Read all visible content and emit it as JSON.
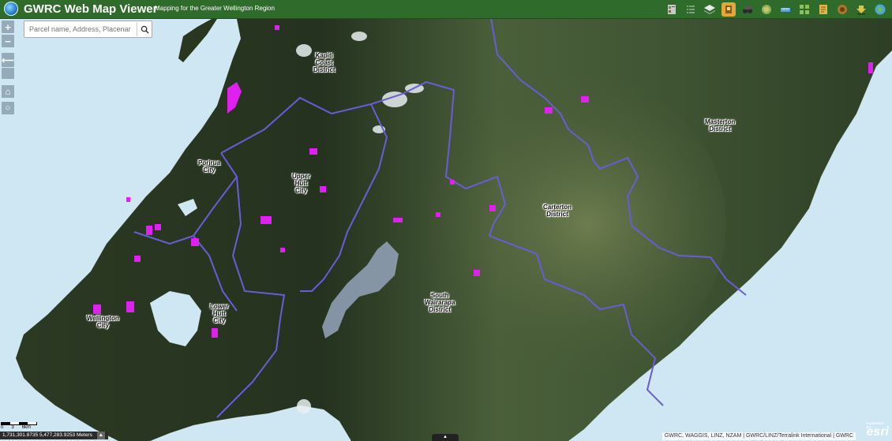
{
  "header": {
    "app_title": "GWRC Web Map Viewer",
    "subtitle": "Mapping for the Greater Wellington Region",
    "tools": [
      {
        "icon": "legend-icon",
        "color": "#c9c9c9"
      },
      {
        "icon": "list-icon",
        "color": "#7fa07a"
      },
      {
        "icon": "layers-icon",
        "color": "#e8e8e8"
      },
      {
        "icon": "basemap-icon",
        "color": "#e0a83a"
      },
      {
        "icon": "binoculars-icon",
        "color": "#e8e8e8"
      },
      {
        "icon": "globe-puzzle-icon",
        "color": "#86b35a"
      },
      {
        "icon": "measure-icon",
        "color": "#5aa2d8"
      },
      {
        "icon": "grid-icon",
        "color": "#8fbf5a"
      },
      {
        "icon": "map-book-icon",
        "color": "#e0b54a"
      },
      {
        "icon": "compass-icon",
        "color": "#b0742a"
      },
      {
        "icon": "download-icon",
        "color": "#e2c23a"
      },
      {
        "icon": "help-globe-icon",
        "color": "#4ba3e0"
      }
    ]
  },
  "search": {
    "placeholder": "Parcel name, Address, Placenar"
  },
  "map_controls": {
    "zoom_in": "+",
    "zoom_out": "−",
    "back": "⟵",
    "home": "⌂",
    "locate": "○"
  },
  "map_labels": [
    {
      "id": "kapiti",
      "lines": [
        "Kapiti",
        "Coast",
        "District"
      ]
    },
    {
      "id": "porirua",
      "lines": [
        "Porirua",
        "City"
      ]
    },
    {
      "id": "upper-hutt",
      "lines": [
        "Upper",
        "Hutt",
        "City"
      ]
    },
    {
      "id": "wellington",
      "lines": [
        "Wellington",
        "City"
      ]
    },
    {
      "id": "lower-hutt",
      "lines": [
        "Lower",
        "Hutt",
        "City"
      ]
    },
    {
      "id": "masterton",
      "lines": [
        "Masterton",
        "District"
      ]
    },
    {
      "id": "carterton",
      "lines": [
        "Carterton",
        "District"
      ]
    },
    {
      "id": "south-wairarapa",
      "lines": [
        "South",
        "Wairarapa",
        "District"
      ]
    }
  ],
  "scale": {
    "ticks": [
      "0",
      "3",
      "6km"
    ]
  },
  "coordinates": "1,731,301.8735 5,477,283.9253 Meters",
  "attribution": "GWRC, WAGGIS, LINZ, NZAM | GWRC/LINZ/Terralink International | GWRC",
  "esri": {
    "brand": "esri",
    "powered_by": "POWERED BY"
  },
  "colors": {
    "header": "#2f6b2a",
    "boundary": "#6a5cd6",
    "highlight": "#e020f0",
    "sea": "#cfe6f3"
  }
}
